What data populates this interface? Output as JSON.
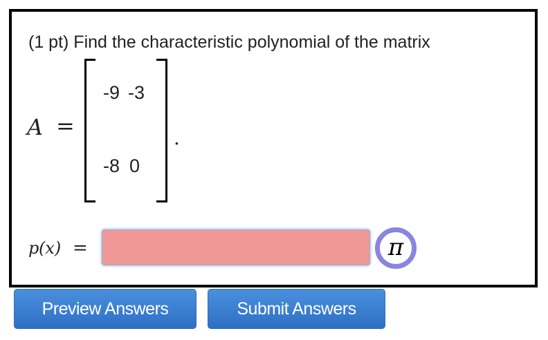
{
  "problem": {
    "prompt": "(1 pt) Find the characteristic polynomial of the matrix",
    "matrix_var": "A",
    "equals": "=",
    "matrix": [
      [
        "-9",
        "-3"
      ],
      [
        "-8",
        "0"
      ]
    ],
    "period": "."
  },
  "answer": {
    "label_func": "p",
    "label_arg": "(x)",
    "equals": "=",
    "value": "",
    "field_color": "#f09895",
    "pi_button_glyph": "π",
    "pi_button_ring_color": "#8a85df"
  },
  "buttons": {
    "preview_label": "Preview Answers",
    "submit_label": "Submit Answers",
    "color": "#3a7fd5"
  }
}
